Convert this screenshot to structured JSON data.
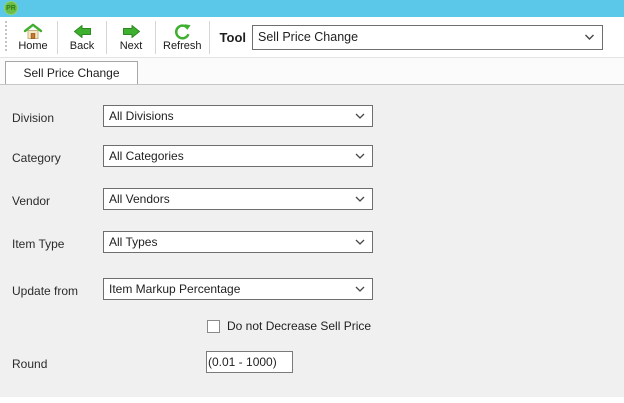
{
  "app": {
    "logo_text": "PR"
  },
  "toolbar": {
    "buttons": [
      {
        "label": "Home",
        "icon": "home-icon"
      },
      {
        "label": "Back",
        "icon": "back-icon"
      },
      {
        "label": "Next",
        "icon": "next-icon"
      },
      {
        "label": "Refresh",
        "icon": "refresh-icon"
      }
    ],
    "tool_label": "Tool",
    "tool_select_value": "Sell Price Change"
  },
  "tabs": [
    {
      "label": "Sell Price Change",
      "active": true
    }
  ],
  "form": {
    "fields": [
      {
        "label": "Division",
        "value": "All Divisions"
      },
      {
        "label": "Category",
        "value": "All Categories"
      },
      {
        "label": "Vendor",
        "value": "All Vendors"
      },
      {
        "label": "Item Type",
        "value": "All Types"
      },
      {
        "label": "Update from",
        "value": "Item Markup Percentage"
      }
    ],
    "checkbox": {
      "label": "Do not Decrease Sell Price",
      "checked": false
    },
    "round": {
      "label": "Round",
      "value": "",
      "hint": "(0.01 - 1000)"
    }
  },
  "colors": {
    "titlebar": "#5CC8E9",
    "logo_green": "#6BBE45",
    "icon_green": "#3FAF2F",
    "content_bg": "#F0F0F0"
  }
}
